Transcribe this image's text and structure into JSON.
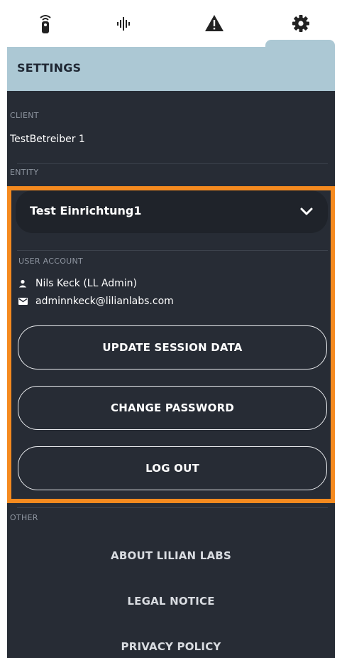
{
  "tabs": [
    {
      "name": "remote-icon",
      "active": false
    },
    {
      "name": "waveform-icon",
      "active": false
    },
    {
      "name": "warning-icon",
      "active": false
    },
    {
      "name": "gear-icon",
      "active": true
    }
  ],
  "header": {
    "title": "SETTINGS"
  },
  "client": {
    "label": "CLIENT",
    "value": "TestBetreiber 1"
  },
  "entity": {
    "label": "ENTITY",
    "selected": "Test Einrichtung1"
  },
  "user_account": {
    "label": "USER ACCOUNT",
    "name": "Nils Keck (LL Admin)",
    "email": "adminnkeck@lilianlabs.com"
  },
  "buttons": {
    "update_session": "UPDATE SESSION DATA",
    "change_password": "CHANGE PASSWORD",
    "log_out": "LOG OUT"
  },
  "other": {
    "label": "OTHER",
    "links": [
      "ABOUT LILIAN LABS",
      "LEGAL NOTICE",
      "PRIVACY POLICY"
    ]
  },
  "colors": {
    "header_bg": "#acc8d4",
    "panel_bg": "#272c35",
    "highlight": "#f58a1f"
  }
}
